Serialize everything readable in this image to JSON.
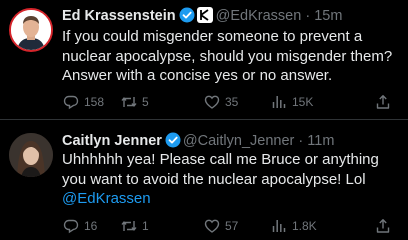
{
  "tweets": [
    {
      "name": "Ed Krassenstein",
      "handle": "@EdKrassen",
      "separator": "·",
      "time": "15m",
      "text": "If you could misgender someone to prevent a nuclear apocalypse, should you misgender them? Answer with a concise yes or no answer.",
      "metrics": {
        "replies": "158",
        "retweets": "5",
        "likes": "35",
        "views": "15K"
      }
    },
    {
      "name": "Caitlyn Jenner",
      "handle": "@Caitlyn_Jenner",
      "separator": "·",
      "time": "11m",
      "text": "Uhhhhhh yea! Please call me Bruce or anything you want to avoid the nuclear apocalypse! Lol",
      "mention": "@EdKrassen",
      "metrics": {
        "replies": "16",
        "retweets": "1",
        "likes": "57",
        "views": "1.8K"
      }
    }
  ],
  "colors": {
    "background": "#000000",
    "text": "#e7e9ea",
    "muted": "#71767b",
    "verified": "#1d9bf0",
    "link": "#1d9bf0",
    "avatar_ring": "#d6252b"
  },
  "icons": [
    "verified-badge-icon",
    "x-grok-icon",
    "reply-icon",
    "retweet-icon",
    "like-icon",
    "views-icon",
    "share-icon"
  ]
}
